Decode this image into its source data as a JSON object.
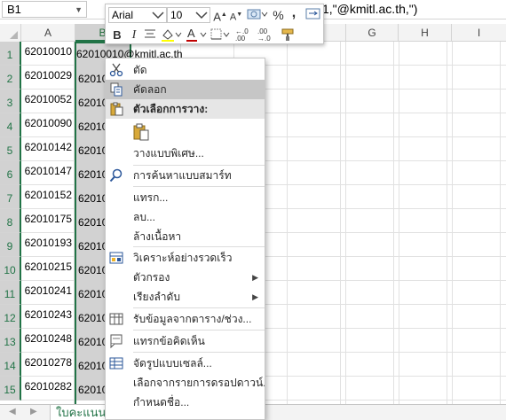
{
  "formula_bar": {
    "name_box": "B1",
    "formula_visible": "1,\"@kmitl.ac.th,\")"
  },
  "columns": [
    "A",
    "B",
    "G",
    "H",
    "I"
  ],
  "selected_column": "B",
  "rows": [
    {
      "num": "1",
      "a": "62010010",
      "b": "62010010@kmitl.ac.th"
    },
    {
      "num": "2",
      "a": "62010029",
      "b": "62010"
    },
    {
      "num": "3",
      "a": "62010052",
      "b": "62010"
    },
    {
      "num": "4",
      "a": "62010090",
      "b": "62010"
    },
    {
      "num": "5",
      "a": "62010142",
      "b": "62010"
    },
    {
      "num": "6",
      "a": "62010147",
      "b": "62010"
    },
    {
      "num": "7",
      "a": "62010152",
      "b": "62010"
    },
    {
      "num": "8",
      "a": "62010175",
      "b": "62010"
    },
    {
      "num": "9",
      "a": "62010193",
      "b": "62010"
    },
    {
      "num": "10",
      "a": "62010215",
      "b": "62010"
    },
    {
      "num": "11",
      "a": "62010241",
      "b": "62010"
    },
    {
      "num": "12",
      "a": "62010243",
      "b": "62010"
    },
    {
      "num": "13",
      "a": "62010248",
      "b": "62010"
    },
    {
      "num": "14",
      "a": "62010278",
      "b": "62010"
    },
    {
      "num": "15",
      "a": "62010282",
      "b": "62010"
    }
  ],
  "mini_toolbar": {
    "font_name": "Arial",
    "font_size": "10",
    "grow_font": "A",
    "shrink_font": "A",
    "percent": "%",
    "comma": ",",
    "bold": "B",
    "italic": "I",
    "font_color_letter": "A",
    "increase_decimal": "←.0\n.00",
    "decrease_decimal": ".00\n→.0"
  },
  "context_menu": {
    "cut": "ตัด",
    "copy": "คัดลอก",
    "paste_options": "ตัวเลือกการวาง:",
    "paste_special": "วางแบบพิเศษ...",
    "smart_lookup": "การค้นหาแบบสมาร์ท",
    "insert": "แทรก...",
    "delete": "ลบ...",
    "clear_contents": "ล้างเนื้อหา",
    "quick_analysis": "วิเคราะห์อย่างรวดเร็ว",
    "filter": "ตัวกรอง",
    "sort": "เรียงลำดับ",
    "get_data": "รับข้อมูลจากตาราง/ช่วง...",
    "insert_comment": "แทรกข้อคิดเห็น",
    "format_cells": "จัดรูปแบบเซลล์...",
    "pick_dropdown": "เลือกจากรายการดรอปดาวน์...",
    "define_name": "กำหนดชื่อ..."
  },
  "sheet_tab": "ใบคะแนนเ"
}
